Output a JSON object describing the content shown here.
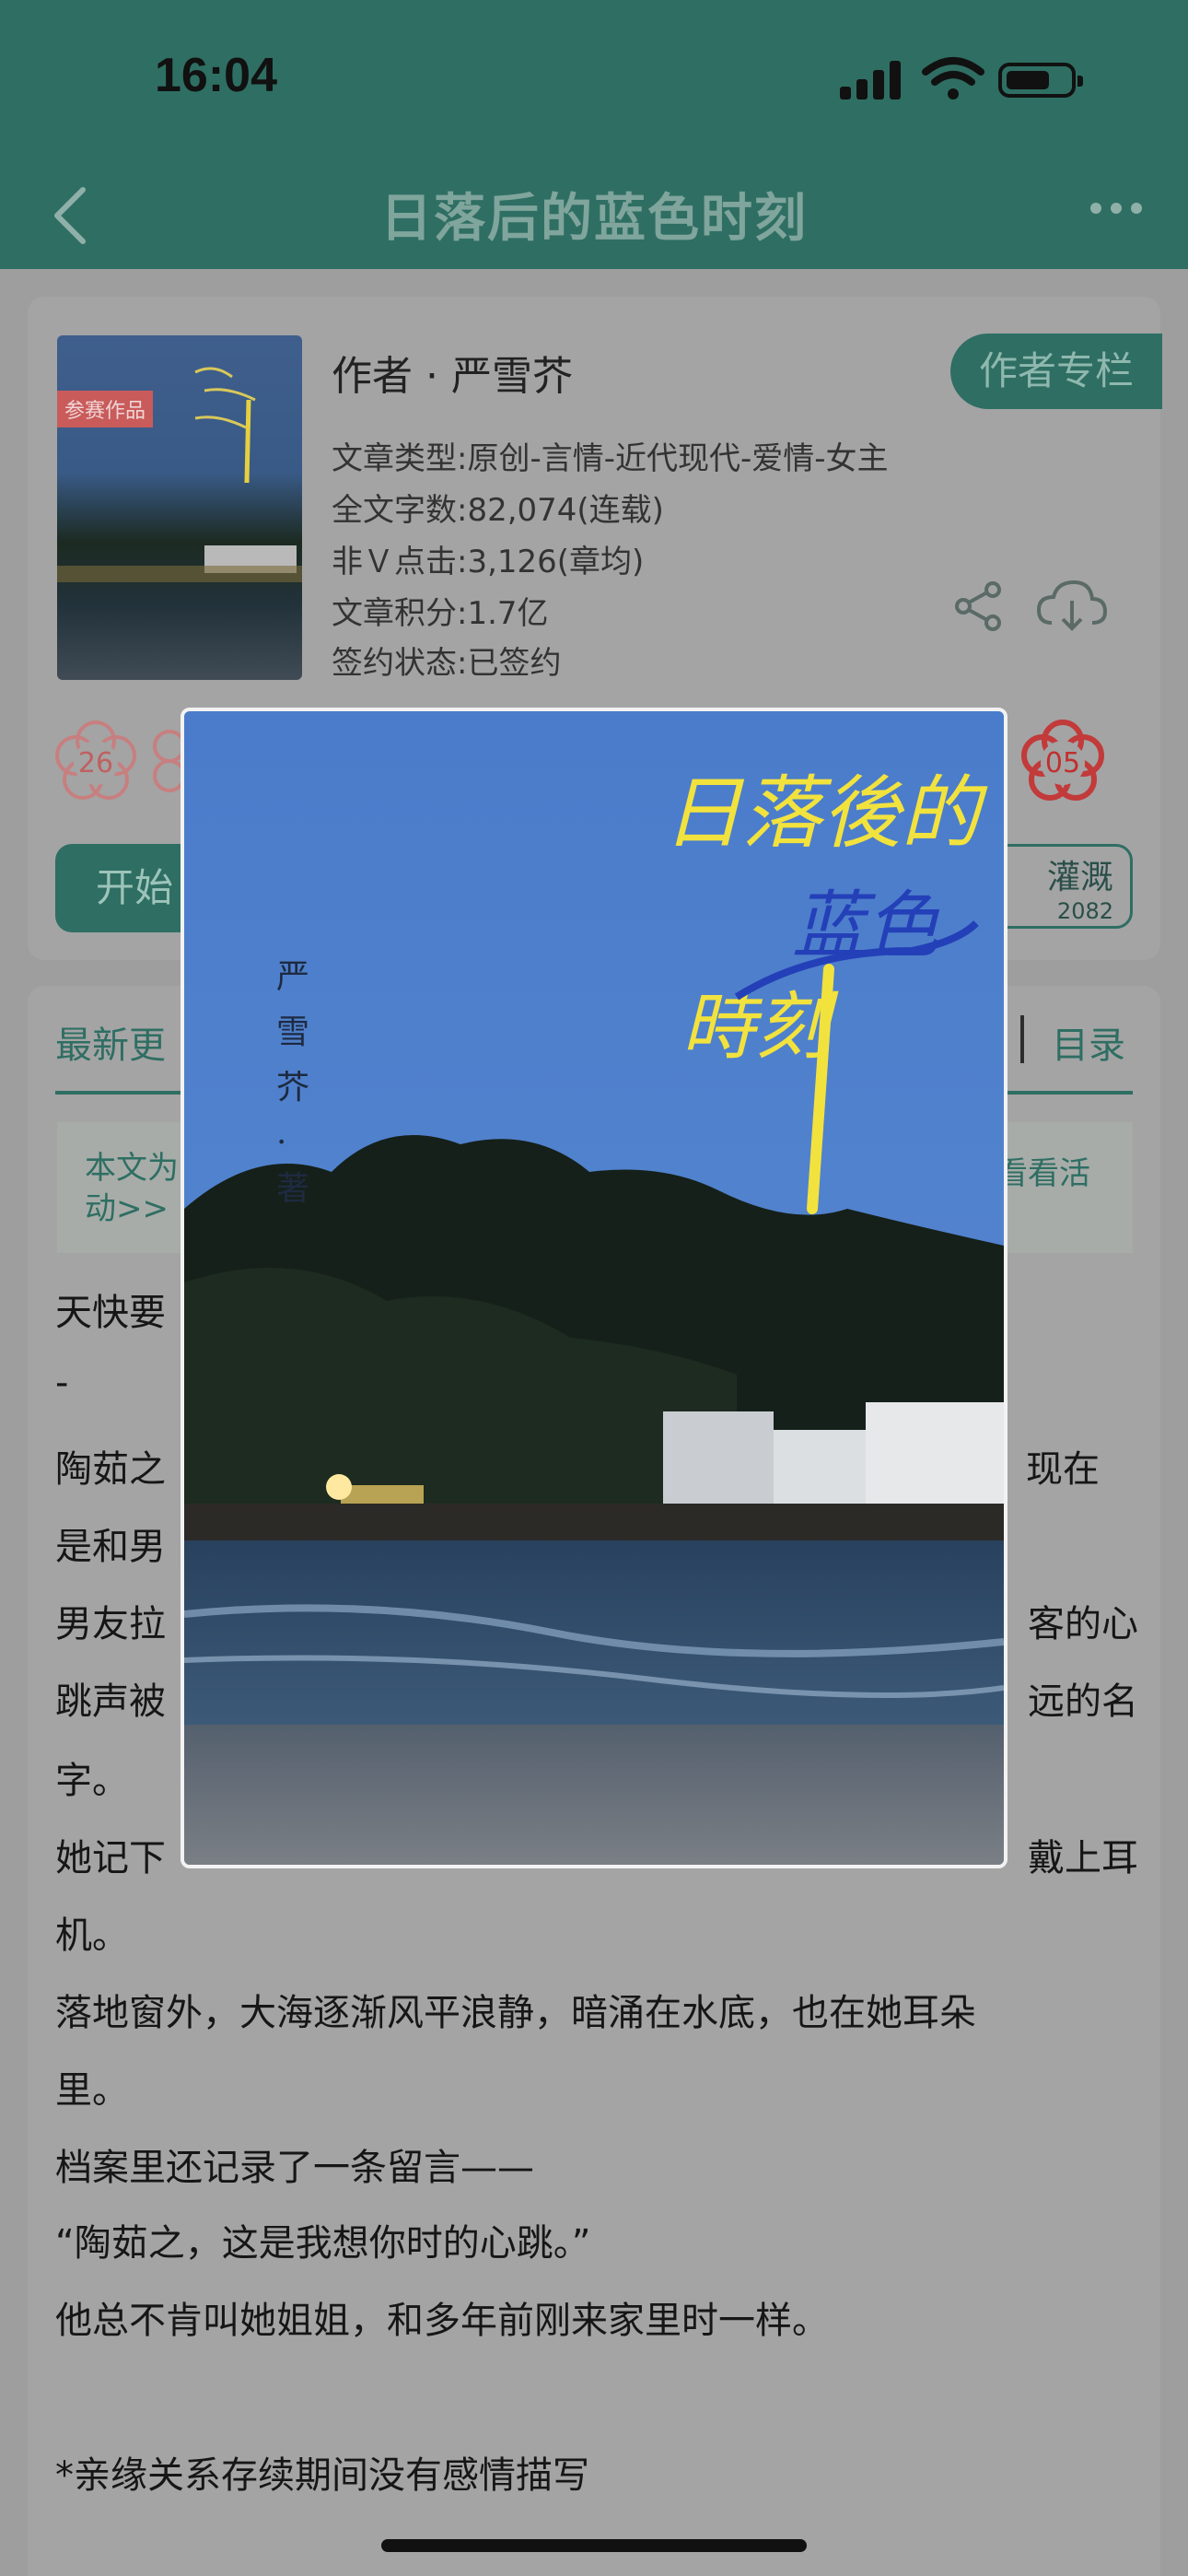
{
  "status_bar": {
    "time": "16:04"
  },
  "nav": {
    "title": "日落后的蓝色时刻"
  },
  "book": {
    "cover_tag": "参赛作品",
    "author_line": "作者 · 严雪芥",
    "author_column_button": "作者专栏",
    "meta": [
      "文章类型:原创-言情-近代现代-爱情-女主",
      "全文字数:82,074(连载)",
      "非Ｖ点击:3,126(章均)",
      "文章积分:1.7亿",
      "签约状态:已签约"
    ],
    "flower_left": "26",
    "flower_right": "05",
    "start_button_partial": "开始",
    "right_button_line1": "灌溉",
    "right_button_line2": "2082"
  },
  "tabs": {
    "latest_partial": "最新更",
    "toc": "目录"
  },
  "notice": {
    "left_partial": "本文为动>>",
    "right_partial": "看看活"
  },
  "content_lines": [
    "天快要",
    "-",
    "陶茹之",
    "现在",
    "是和男",
    "男友拉",
    "客的心",
    "跳声被",
    "远的名",
    "字。",
    "她记下",
    "戴上耳",
    "机。",
    "落地窗外，大海逐渐风平浪静，暗涌在水底，也在她耳朵",
    "里。",
    "档案里还记录了一条留言——",
    "“陶茹之，这是我想你时的心跳。”",
    "他总不肯叫她姐姐，和多年前刚来家里时一样。",
    "*亲缘关系存续期间没有感情描写"
  ],
  "cover_popup": {
    "title_script": "日落後的蓝色時刻",
    "author_vertical": "严雪芥·著"
  },
  "colors": {
    "brand_green": "#2f6e63",
    "dim_overlay": "#9e9e9e",
    "sky_blue": "#4d7fc6"
  }
}
